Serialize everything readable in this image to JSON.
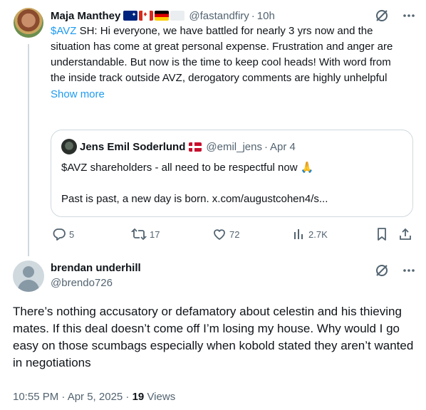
{
  "tweet1": {
    "display_name": "Maja Manthey",
    "handle": "@fastandfiry",
    "separator": "·",
    "time": "10h",
    "cashtag": "$AVZ",
    "text": " SH: Hi everyone, we have battled for nearly 3 yrs now and the situation has come at great personal expense. Frustration and anger are understandable. But now is the time to keep cool heads! With word from the inside track outside AVZ, derogatory comments are highly unhelpful",
    "show_more": "Show more",
    "quote": {
      "display_name": "Jens Emil Soderlund",
      "handle": "@emil_jens",
      "separator": "·",
      "time": "Apr 4",
      "line1": "$AVZ shareholders - all need to be respectful now 🙏",
      "line2": "Past is past, a new day is born. x.com/augustcohen4/s..."
    },
    "actions": {
      "replies": "5",
      "retweets": "17",
      "likes": "72",
      "views": "2.7K"
    }
  },
  "tweet2": {
    "display_name": "brendan underhill",
    "handle": "@brendo726",
    "text": "There’s nothing accusatory or defamatory about celestin and his thieving mates. If this deal doesn’t come off I’m losing my house. Why would I go easy on those scumbags especially when kobold stated they aren’t wanted in negotiations",
    "timestamp": "10:55 PM · Apr 5, 2025 · ",
    "views_count": "19",
    "views_label": " Views"
  },
  "colors": {
    "link": "#1d9bf0",
    "muted": "#536471",
    "text": "#0f1419",
    "border": "#cfd9de"
  }
}
